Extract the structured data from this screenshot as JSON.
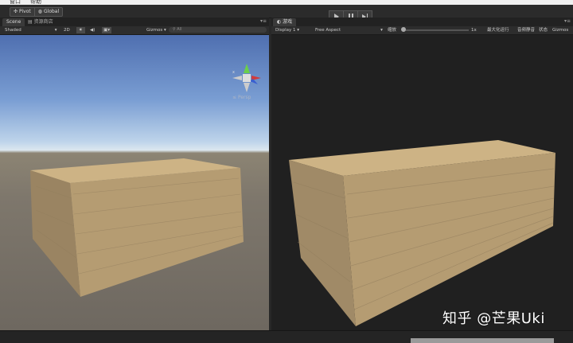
{
  "menu": {
    "items": [
      "窗口",
      "帮助"
    ]
  },
  "toolbar": {
    "pivot_label": "Pivot",
    "global_label": "Global",
    "play_icon": "play-icon",
    "pause_icon": "pause-icon",
    "step_icon": "step-icon"
  },
  "scene": {
    "tab_label": "Scene",
    "second_tab_label": "资源商店",
    "shading_mode": "Shaded",
    "mode_2d": "2D",
    "gizmos_label": "Gizmos",
    "search_placeholder": "All",
    "persp_label": "Persp"
  },
  "game": {
    "tab_label": "游戏",
    "display": "Display 1",
    "aspect": "Free Aspect",
    "scale_label": "缩放",
    "scale_value": "1x",
    "maximize_label": "最大化运行",
    "mute_label": "音频静音",
    "stats_label": "状态",
    "gizmos_label": "Gizmos"
  },
  "watermark": {
    "text": "知乎 @芒果Uki"
  },
  "colors": {
    "sky_top": "#4f6fb0",
    "ground": "#7e776c",
    "game_bg": "#202020",
    "wood": "#b59c72"
  }
}
